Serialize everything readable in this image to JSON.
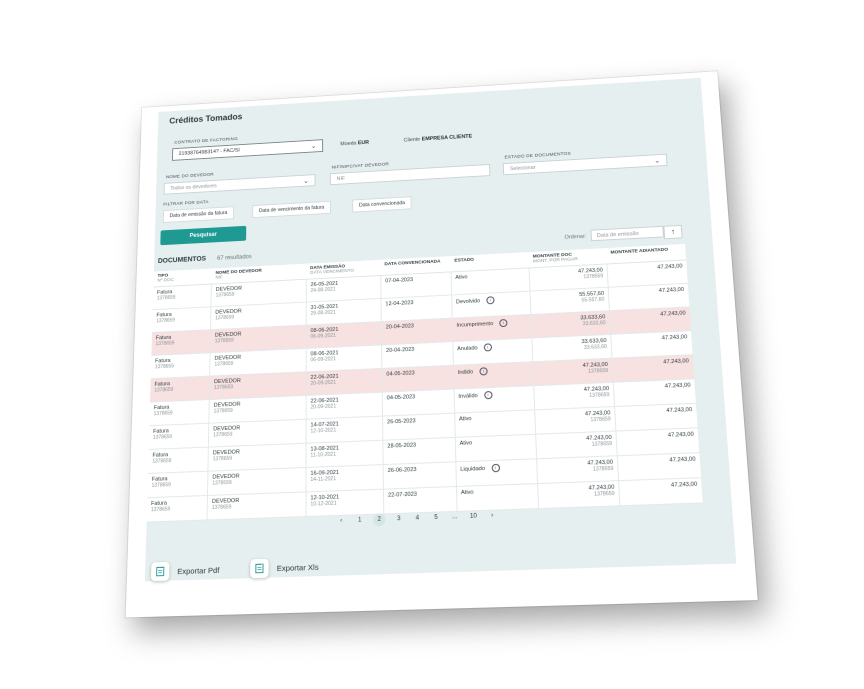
{
  "page": {
    "title": "Créditos Tomados",
    "contract_label": "CONTRATO DE FACTORING",
    "contract_value": "2193876498314? - FAC/SI",
    "currency_label": "Moeda",
    "currency_value": "EUR",
    "client_label": "Cliente",
    "client_value": "EMPRESA CLIENTE",
    "debtor_label": "NOME DO DEVEDOR",
    "debtor_value": "Todos os devedores",
    "nif_label": "NIF/NIPC/VAT DEVEDOR",
    "nif_placeholder": "NIF",
    "state_label": "ESTADO DE DOCUMENTOS",
    "state_value": "Selecionar",
    "filter_date_label": "FILTRAR POR DATA",
    "filter_chips": [
      "Data de emissão da fatura",
      "Data de vencimento da fatura",
      "Data convencionada"
    ],
    "search_button": "Pesquisar",
    "docs_title": "DOCUMENTOS",
    "docs_count": "67 resultados",
    "order_label": "Ordenar:",
    "order_value": "Data de emissão",
    "sort_icon": "arrow-up-icon"
  },
  "table": {
    "headers": [
      {
        "main": "TIPO",
        "sub": "Nº DOC"
      },
      {
        "main": "NOME DO DEVEDOR",
        "sub": "NIF"
      },
      {
        "main": "DATA EMISSÃO",
        "sub": "DATA VENCIMENTO"
      },
      {
        "main": "DATA CONVENCIONADA",
        "sub": ""
      },
      {
        "main": "ESTADO",
        "sub": ""
      },
      {
        "main": "MONTANTE DOC",
        "sub": "MONT. POR PAGAR"
      },
      {
        "main": "MONTANTE ADIANTADO",
        "sub": ""
      }
    ],
    "rows": [
      {
        "type": "Fatura",
        "doc": "1378659",
        "debtor": "DEVEDOR",
        "nif": "1378659",
        "emit": "26-05-2021",
        "due": "24-08-2021",
        "conv": "07-04-2023",
        "state": "Ativo",
        "info": false,
        "amount": "47.243,00",
        "pending": "1378659",
        "adv": "47.243,00",
        "alert": false
      },
      {
        "type": "Fatura",
        "doc": "1378659",
        "debtor": "DEVEDOR",
        "nif": "1378659",
        "emit": "31-05-2021",
        "due": "29-08-2021",
        "conv": "12-04-2023",
        "state": "Devolvido",
        "info": true,
        "amount": "55.557,60",
        "pending": "55.557,60",
        "adv": "47.243,00",
        "alert": false
      },
      {
        "type": "Fatura",
        "doc": "1378659",
        "debtor": "DEVEDOR",
        "nif": "1378659",
        "emit": "08-06-2021",
        "due": "06-09-2021",
        "conv": "20-04-2023",
        "state": "Incumprimento",
        "info": true,
        "amount": "33.633,60",
        "pending": "33.633,60",
        "adv": "47.243,00",
        "alert": true
      },
      {
        "type": "Fatura",
        "doc": "1378659",
        "debtor": "DEVEDOR",
        "nif": "1378659",
        "emit": "08-06-2021",
        "due": "06-09-2021",
        "conv": "20-04-2023",
        "state": "Anulado",
        "info": true,
        "amount": "33.633,60",
        "pending": "33.633,60",
        "adv": "47.243,00",
        "alert": false
      },
      {
        "type": "Fatura",
        "doc": "1378659",
        "debtor": "DEVEDOR",
        "nif": "1378659",
        "emit": "22-06-2021",
        "due": "20-09-2021",
        "conv": "04-05-2023",
        "state": "Indido",
        "info": true,
        "amount": "47.243,00",
        "pending": "1378659",
        "adv": "47.243,00",
        "alert": true
      },
      {
        "type": "Fatura",
        "doc": "1378659",
        "debtor": "DEVEDOR",
        "nif": "1378659",
        "emit": "22-06-2021",
        "due": "20-09-2021",
        "conv": "04-05-2023",
        "state": "Inválido",
        "info": true,
        "amount": "47.243,00",
        "pending": "1378659",
        "adv": "47.243,00",
        "alert": false
      },
      {
        "type": "Fatura",
        "doc": "1378659",
        "debtor": "DEVEDOR",
        "nif": "1378659",
        "emit": "14-07-2021",
        "due": "12-10-2021",
        "conv": "26-05-2023",
        "state": "Ativo",
        "info": false,
        "amount": "47.243,00",
        "pending": "1378659",
        "adv": "47.243,00",
        "alert": false
      },
      {
        "type": "Fatura",
        "doc": "1378659",
        "debtor": "DEVEDOR",
        "nif": "1378659",
        "emit": "13-08-2021",
        "due": "11-10-2021",
        "conv": "28-05-2023",
        "state": "Ativo",
        "info": false,
        "amount": "47.243,00",
        "pending": "1378659",
        "adv": "47.243,00",
        "alert": false
      },
      {
        "type": "Fatura",
        "doc": "1378659",
        "debtor": "DEVEDOR",
        "nif": "1378659",
        "emit": "16-09-2021",
        "due": "14-11-2021",
        "conv": "26-06-2023",
        "state": "Liquidado",
        "info": true,
        "amount": "47.243,00",
        "pending": "1378659",
        "adv": "47.243,00",
        "alert": false
      },
      {
        "type": "Fatura",
        "doc": "1378659",
        "debtor": "DEVEDOR",
        "nif": "1378659",
        "emit": "12-10-2021",
        "due": "10-12-2021",
        "conv": "22-07-2023",
        "state": "Ativo",
        "info": false,
        "amount": "47.243,00",
        "pending": "1378659",
        "adv": "47.243,00",
        "alert": false
      }
    ]
  },
  "pager": {
    "prev_icon": "chevron-left-icon",
    "pages": [
      "1",
      "2",
      "3",
      "4",
      "5",
      "...",
      "10"
    ],
    "current": "2",
    "next_icon": "chevron-right-icon"
  },
  "exports": [
    {
      "label": "Exportar Pdf",
      "icon": "pdf-document-icon"
    },
    {
      "label": "Exportar Xls",
      "icon": "xls-document-icon"
    }
  ]
}
